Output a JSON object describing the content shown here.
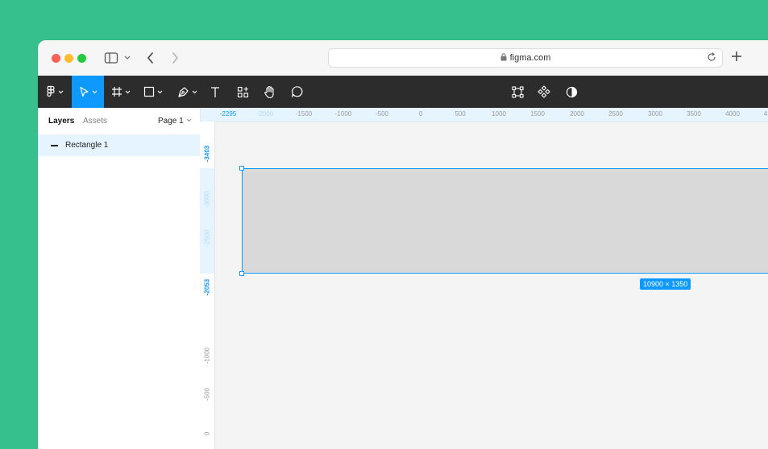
{
  "browser": {
    "url": "figma.com",
    "icons": [
      "sidebar-icon",
      "chevron-down-icon",
      "back-icon",
      "forward-icon",
      "lock-icon",
      "reload-icon",
      "new-tab-icon"
    ]
  },
  "toolbar": {
    "tools": [
      {
        "name": "main-menu",
        "icon": "figma-logo-icon"
      },
      {
        "name": "move-tool",
        "icon": "cursor-icon",
        "active": true
      },
      {
        "name": "frame-tool",
        "icon": "frame-icon"
      },
      {
        "name": "shape-tool",
        "icon": "rectangle-icon"
      },
      {
        "name": "pen-tool",
        "icon": "pen-icon"
      },
      {
        "name": "text-tool",
        "icon": "text-icon"
      },
      {
        "name": "resources-tool",
        "icon": "resources-icon"
      },
      {
        "name": "hand-tool",
        "icon": "hand-icon"
      },
      {
        "name": "comment-tool",
        "icon": "comment-icon"
      }
    ],
    "center_tools": [
      "edit-object-icon",
      "component-icon",
      "contrast-icon"
    ],
    "active_color": "#0d99ff",
    "background": "#2c2c2c"
  },
  "panel": {
    "tabs": {
      "layers": "Layers",
      "assets": "Assets"
    },
    "page": "Page 1",
    "layers": [
      {
        "name": "Rectangle 1",
        "selected": true
      }
    ]
  },
  "rulers": {
    "top": [
      "-2295",
      "-2000",
      "-1500",
      "-1000",
      "-500",
      "0",
      "500",
      "1000",
      "1500",
      "2000",
      "2500",
      "3000",
      "3500",
      "4000",
      "4"
    ],
    "left": {
      "sel_start": "-3403",
      "inside": [
        "-3000",
        "-2500"
      ],
      "sel_end": "-2053",
      "below": [
        "-1000",
        "-500",
        "0"
      ]
    }
  },
  "canvas": {
    "selection": {
      "label": "10900 × 1350"
    }
  },
  "colors": {
    "selection": "#0d99ff",
    "rectangle_fill": "#d9d9d9",
    "canvas_bg": "#f4f4f4",
    "desktop_bg": "#35c08d"
  }
}
